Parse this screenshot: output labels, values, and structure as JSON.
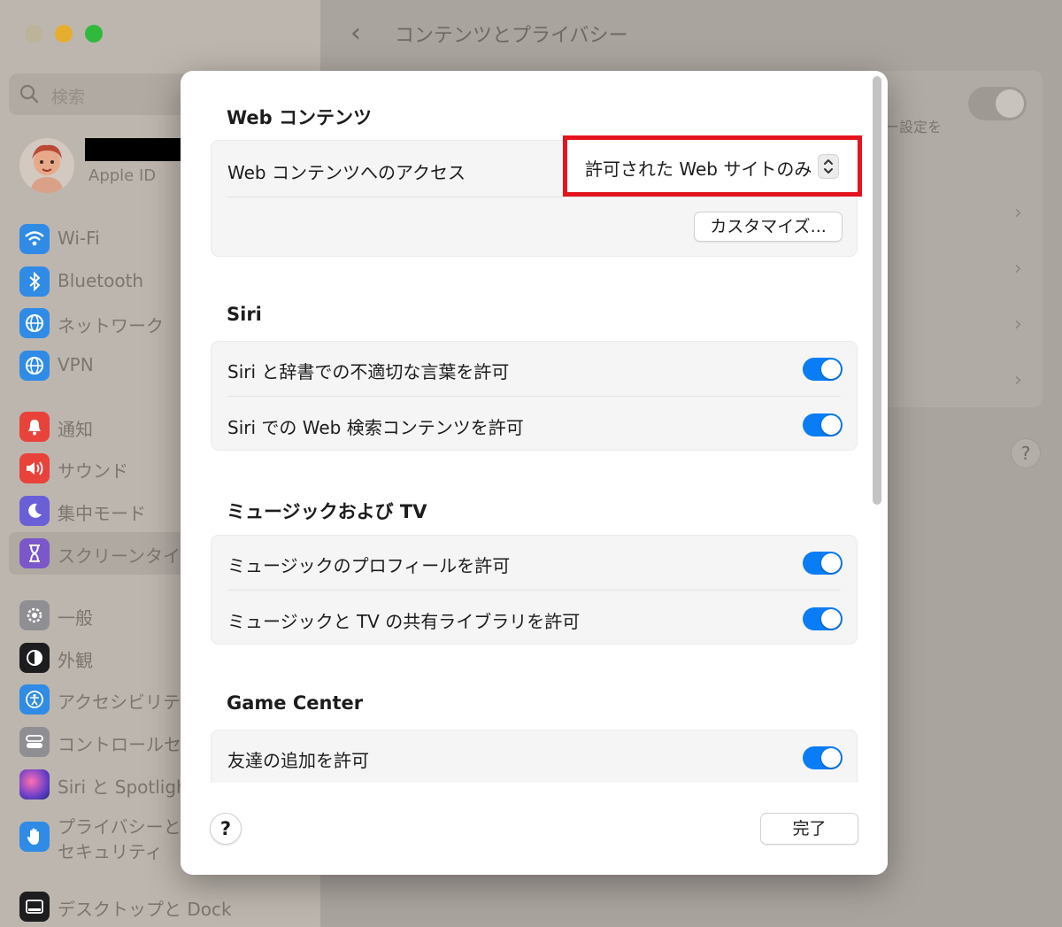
{
  "window": {
    "title": "コンテンツとプライバシー",
    "back_icon": "chevron-left-icon"
  },
  "sidebar": {
    "search_placeholder": "検索",
    "account_label": "Apple ID",
    "items": [
      {
        "label": "Wi-Fi",
        "icon": "wifi-icon",
        "color": "#2f8be6"
      },
      {
        "label": "Bluetooth",
        "icon": "bluetooth-icon",
        "color": "#2f8be6"
      },
      {
        "label": "ネットワーク",
        "icon": "globe-icon",
        "color": "#2f8be6"
      },
      {
        "label": "VPN",
        "icon": "vpn-globe-icon",
        "color": "#2f8be6"
      },
      {
        "label": "通知",
        "icon": "bell-icon",
        "color": "#e8423b"
      },
      {
        "label": "サウンド",
        "icon": "speaker-icon",
        "color": "#e8423b"
      },
      {
        "label": "集中モード",
        "icon": "moon-icon",
        "color": "#6a5fd6"
      },
      {
        "label": "スクリーンタイム",
        "icon": "hourglass-icon",
        "color": "#7b57c9"
      },
      {
        "label": "一般",
        "icon": "gear-icon",
        "color": "#8e8e93"
      },
      {
        "label": "外観",
        "icon": "appearance-icon",
        "color": "#1d1d1f"
      },
      {
        "label": "アクセシビリティ",
        "icon": "accessibility-icon",
        "color": "#2f8be6"
      },
      {
        "label": "コントロールセンター",
        "icon": "control-center-icon",
        "color": "#8e8e93"
      },
      {
        "label": "Siri と Spotlight",
        "icon": "siri-icon",
        "color": "#6b3fc9"
      },
      {
        "label": "プライバシーと",
        "label2": "セキュリティ",
        "icon": "hand-icon",
        "color": "#2f8be6"
      },
      {
        "label": "デスクトップと Dock",
        "icon": "dock-icon",
        "color": "#1d1d1f"
      }
    ]
  },
  "background_main": {
    "desc_fragment": "ー設定を",
    "help_label": "?"
  },
  "sheet": {
    "sections": [
      {
        "title": "Web コンテンツ",
        "rows": [
          {
            "label": "Web コンテンツへのアクセス",
            "popup_value": "許可された Web サイトのみ"
          }
        ],
        "customize_label": "カスタマイズ..."
      },
      {
        "title": "Siri",
        "rows": [
          {
            "label": "Siri と辞書での不適切な言葉を許可",
            "toggle": true
          },
          {
            "label": "Siri での Web 検索コンテンツを許可",
            "toggle": true
          }
        ]
      },
      {
        "title": "ミュージックおよび TV",
        "rows": [
          {
            "label": "ミュージックのプロフィールを許可",
            "toggle": true
          },
          {
            "label": "ミュージックと TV の共有ライブラリを許可",
            "toggle": true
          }
        ]
      },
      {
        "title": "Game Center",
        "rows": [
          {
            "label": "友達の追加を許可",
            "toggle": true
          }
        ]
      }
    ],
    "help_label": "?",
    "done_label": "完了",
    "highlight_color": "#e3141e",
    "toggle_color": "#0a7cf5"
  }
}
